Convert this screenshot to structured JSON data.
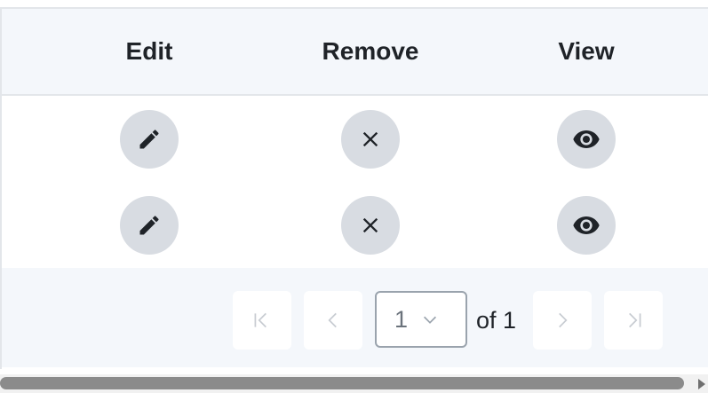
{
  "table": {
    "columns": [
      {
        "key": "edit",
        "label": "Edit"
      },
      {
        "key": "remove",
        "label": "Remove"
      },
      {
        "key": "view",
        "label": "View"
      }
    ],
    "rows": [
      {
        "edit_icon": "pencil-icon",
        "remove_icon": "close-icon",
        "view_icon": "eye-icon"
      },
      {
        "edit_icon": "pencil-icon",
        "remove_icon": "close-icon",
        "view_icon": "eye-icon"
      }
    ]
  },
  "pagination": {
    "current_page": "1",
    "of_text": "of 1",
    "first_icon": "first-page-icon",
    "prev_icon": "chevron-left-icon",
    "next_icon": "chevron-right-icon",
    "last_icon": "last-page-icon",
    "dropdown_icon": "chevron-down-icon"
  },
  "colors": {
    "header_bg": "#f4f7fb",
    "icon_button_bg": "#d8dce2",
    "border": "#e3e6ea",
    "text": "#1f2328",
    "disabled_icon": "#c8ccd2"
  }
}
